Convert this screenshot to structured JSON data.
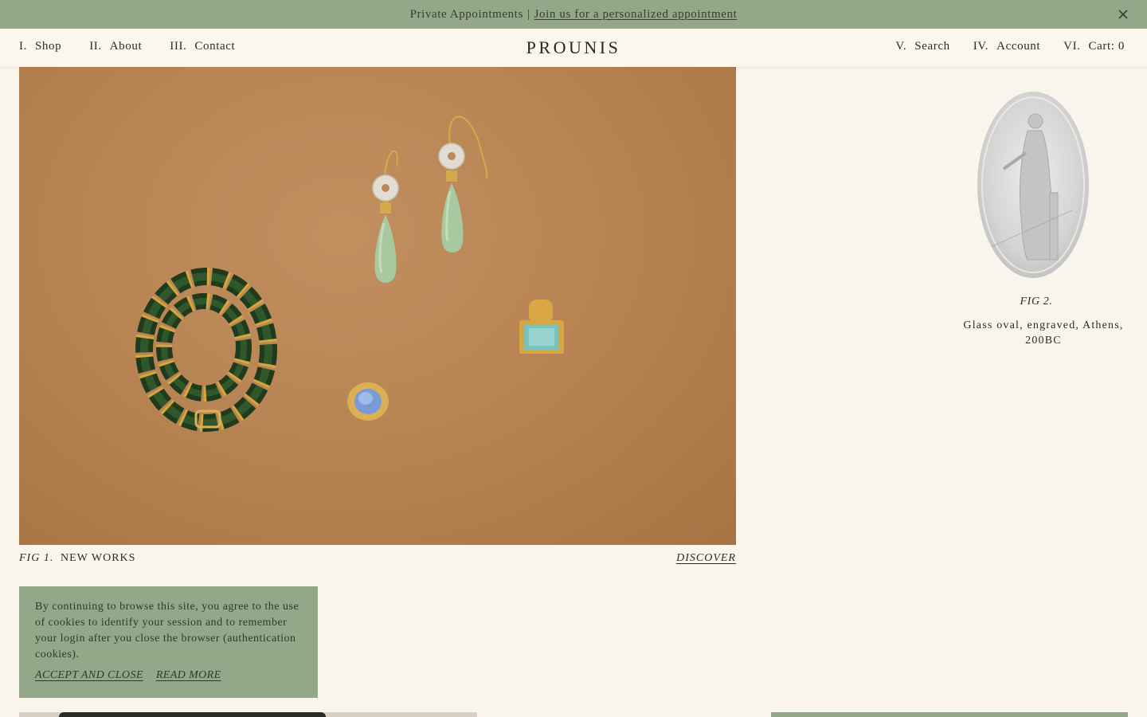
{
  "announcement": {
    "text": "Private Appointments",
    "separator": "|",
    "link": "Join us for a personalized appointment"
  },
  "header": {
    "logo": "PROUNIS",
    "nav_left": [
      {
        "numeral": "I.",
        "label": "Shop"
      },
      {
        "numeral": "II.",
        "label": "About"
      },
      {
        "numeral": "III.",
        "label": "Contact"
      }
    ],
    "nav_right": [
      {
        "numeral": "V.",
        "label": "Search"
      },
      {
        "numeral": "IV.",
        "label": "Account"
      },
      {
        "numeral": "VI.",
        "label": "Cart: 0"
      }
    ]
  },
  "hero": {
    "fig_label": "FIG 1.",
    "title": "NEW WORKS",
    "cta": "DISCOVER"
  },
  "fig2": {
    "label": "FIG 2.",
    "caption": "Glass oval, engraved, Athens, 200BC"
  },
  "cookie": {
    "text": "By continuing to browse this site, you agree to the use of cookies to identify your session and to remember your login after you close the browser (authentication cookies).",
    "accept": "ACCEPT AND CLOSE",
    "read_more": "READ MORE"
  },
  "colors": {
    "sage": "#93a888",
    "cream": "#f9f5ec",
    "suede": "#b88454"
  },
  "icons": [
    "close-icon"
  ]
}
